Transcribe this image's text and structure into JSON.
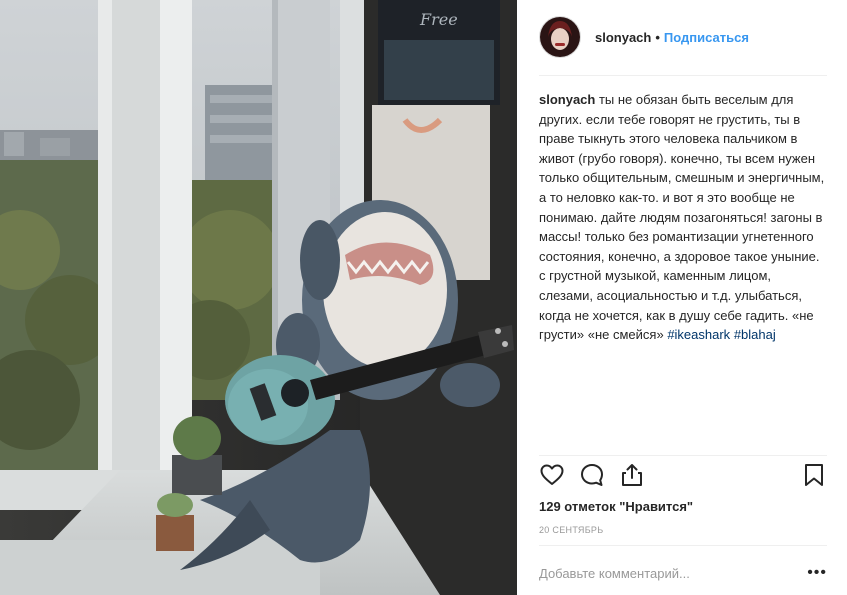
{
  "post": {
    "username": "slonyach",
    "dot": "•",
    "follow_label": "Подписаться",
    "caption": {
      "username": "slonyach",
      "text": " ты не обязан быть веселым для других. если тебе говорят не грустить, ты в праве тыкнуть этого человека пальчиком в живот (грубо говоря). конечно, ты всем нужен только общительным, смешным и энергичным, а то неловко как-то. и вот я это вообще не понимаю. дайте людям позагоняться! загоны в массы! только без романтизации угнетенного состояния, конечно, а здоровое такое уныние. с грустной музыкой, каменным лицом, слезами, асоциальностью и т.д. улыбаться, когда не хочется, как в душу себе гадить. «не грусти» «не смейся» ",
      "hashtag_1": "#ikeashark",
      "hashtag_2": "#blahaj"
    },
    "likes_text": "129 отметок \"Нравится\"",
    "date": "20 сентябрь",
    "comment_placeholder": "Добавьте комментарий...",
    "more_label": "•••",
    "poster_text": "Free"
  },
  "icons": {
    "like": "heart-icon",
    "comment": "comment-icon",
    "share": "share-icon",
    "save": "bookmark-icon"
  },
  "colors": {
    "accent": "#3897f0",
    "hashtag": "#003569",
    "text": "#262626",
    "muted": "#999999"
  }
}
